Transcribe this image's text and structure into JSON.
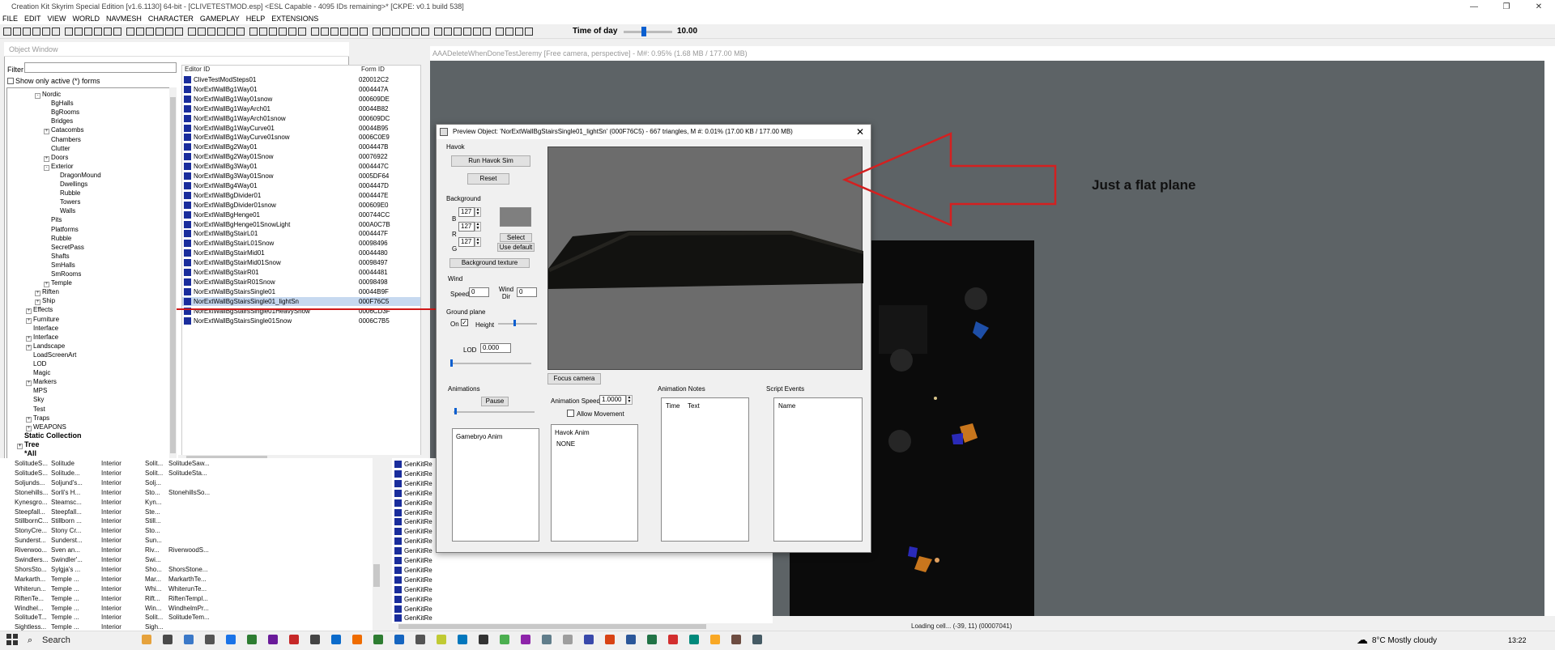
{
  "app": {
    "title": "Creation Kit Skyrim Special Edition [v1.6.1130] 64-bit - [CLIVETESTMOD.esp] <ESL Capable - 4095 IDs remaining>* [CKPE: v0.1 build 538]"
  },
  "menu": [
    "FILE",
    "EDIT",
    "VIEW",
    "WORLD",
    "NAVMESH",
    "CHARACTER",
    "GAMEPLAY",
    "HELP",
    "EXTENSIONS"
  ],
  "time_of_day": {
    "label": "Time of day",
    "value": "10.00",
    "level": 0.42
  },
  "object_window": {
    "title": "Object Window",
    "filter_label": "Filter",
    "filter_value": "",
    "active_only_label": "Show only active (*) forms",
    "col_editor_id": "Editor ID",
    "col_form_id": "Form ID",
    "tree": [
      {
        "label": "Nordic",
        "depth": 2,
        "exp": "-"
      },
      {
        "label": "BgHalls",
        "depth": 3,
        "exp": ""
      },
      {
        "label": "BgRooms",
        "depth": 3,
        "exp": ""
      },
      {
        "label": "Bridges",
        "depth": 3,
        "exp": ""
      },
      {
        "label": "Catacombs",
        "depth": 3,
        "exp": "+"
      },
      {
        "label": "Chambers",
        "depth": 3,
        "exp": ""
      },
      {
        "label": "Clutter",
        "depth": 3,
        "exp": ""
      },
      {
        "label": "Doors",
        "depth": 3,
        "exp": "+"
      },
      {
        "label": "Exterior",
        "depth": 3,
        "exp": "-"
      },
      {
        "label": "DragonMound",
        "depth": 4,
        "exp": ""
      },
      {
        "label": "Dwellings",
        "depth": 4,
        "exp": ""
      },
      {
        "label": "Rubble",
        "depth": 4,
        "exp": ""
      },
      {
        "label": "Towers",
        "depth": 4,
        "exp": ""
      },
      {
        "label": "Walls",
        "depth": 4,
        "exp": ""
      },
      {
        "label": "Pits",
        "depth": 3,
        "exp": ""
      },
      {
        "label": "Platforms",
        "depth": 3,
        "exp": ""
      },
      {
        "label": "Rubble",
        "depth": 3,
        "exp": ""
      },
      {
        "label": "SecretPass",
        "depth": 3,
        "exp": ""
      },
      {
        "label": "Shafts",
        "depth": 3,
        "exp": ""
      },
      {
        "label": "SmHalls",
        "depth": 3,
        "exp": ""
      },
      {
        "label": "SmRooms",
        "depth": 3,
        "exp": ""
      },
      {
        "label": "Temple",
        "depth": 3,
        "exp": "+"
      },
      {
        "label": "Riften",
        "depth": 2,
        "exp": "+"
      },
      {
        "label": "Ship",
        "depth": 2,
        "exp": "+"
      },
      {
        "label": "Effects",
        "depth": 1,
        "exp": "+"
      },
      {
        "label": "Furniture",
        "depth": 1,
        "exp": "+"
      },
      {
        "label": "Interface",
        "depth": 1,
        "exp": ""
      },
      {
        "label": "Interface",
        "depth": 1,
        "exp": "+"
      },
      {
        "label": "Landscape",
        "depth": 1,
        "exp": "+"
      },
      {
        "label": "LoadScreenArt",
        "depth": 1,
        "exp": ""
      },
      {
        "label": "LOD",
        "depth": 1,
        "exp": ""
      },
      {
        "label": "Magic",
        "depth": 1,
        "exp": ""
      },
      {
        "label": "Markers",
        "depth": 1,
        "exp": "+"
      },
      {
        "label": "MPS",
        "depth": 1,
        "exp": ""
      },
      {
        "label": "Sky",
        "depth": 1,
        "exp": ""
      },
      {
        "label": "Test",
        "depth": 1,
        "exp": ""
      },
      {
        "label": "Traps",
        "depth": 1,
        "exp": "+"
      },
      {
        "label": "WEAPONS",
        "depth": 1,
        "exp": "+"
      },
      {
        "label": "Static Collection",
        "depth": 0,
        "exp": "",
        "bold": true
      },
      {
        "label": "Tree",
        "depth": 0,
        "exp": "+",
        "bold": true
      },
      {
        "label": "*All",
        "depth": 0,
        "exp": "",
        "bold": true
      }
    ],
    "rows": [
      {
        "name": "CliveTestModSteps01",
        "id": "020012C2"
      },
      {
        "name": "NorExtWallBg1Way01",
        "id": "0004447A"
      },
      {
        "name": "NorExtWallBg1Way01snow",
        "id": "000609DE"
      },
      {
        "name": "NorExtWallBg1WayArch01",
        "id": "00044B82"
      },
      {
        "name": "NorExtWallBg1WayArch01snow",
        "id": "000609DC"
      },
      {
        "name": "NorExtWallBg1WayCurve01",
        "id": "00044B95"
      },
      {
        "name": "NorExtWallBg1WayCurve01snow",
        "id": "0006C0E9"
      },
      {
        "name": "NorExtWallBg2Way01",
        "id": "0004447B"
      },
      {
        "name": "NorExtWallBg2Way01Snow",
        "id": "00076922"
      },
      {
        "name": "NorExtWallBg3Way01",
        "id": "0004447C"
      },
      {
        "name": "NorExtWallBg3Way01Snow",
        "id": "0005DF64"
      },
      {
        "name": "NorExtWallBg4Way01",
        "id": "0004447D"
      },
      {
        "name": "NorExtWallBgDivider01",
        "id": "0004447E"
      },
      {
        "name": "NorExtWallBgDivider01snow",
        "id": "000609E0"
      },
      {
        "name": "NorExtWallBgHenge01",
        "id": "000744CC"
      },
      {
        "name": "NorExtWallBgHenge01SnowLight",
        "id": "000A0C7B"
      },
      {
        "name": "NorExtWallBgStairL01",
        "id": "0004447F"
      },
      {
        "name": "NorExtWallBgStairL01Snow",
        "id": "00098496"
      },
      {
        "name": "NorExtWallBgStairMid01",
        "id": "00044480"
      },
      {
        "name": "NorExtWallBgStairMid01Snow",
        "id": "00098497"
      },
      {
        "name": "NorExtWallBgStairR01",
        "id": "00044481"
      },
      {
        "name": "NorExtWallBgStairR01Snow",
        "id": "00098498"
      },
      {
        "name": "NorExtWallBgStairsSingle01",
        "id": "00044B9F"
      },
      {
        "name": "NorExtWallBgStairsSingle01_lightSn",
        "id": "000F76C5",
        "sel": true
      },
      {
        "name": "NorExtWallBgStairsSingle01HeavySnow",
        "id": "0006CD3F"
      },
      {
        "name": "NorExtWallBgStairsSingle01Snow",
        "id": "0006C7B5"
      }
    ]
  },
  "cells": [
    [
      "SolitudeS...",
      "Solitude",
      "Interior",
      "Solit...",
      "SolitudeSaw..."
    ],
    [
      "SolitudeS...",
      "Solitude...",
      "Interior",
      "Solit...",
      "SolitudeSta..."
    ],
    [
      "Soljunds...",
      "Soljund's...",
      "Interior",
      "Solj...",
      ""
    ],
    [
      "Stonehills...",
      "Sorli's H...",
      "Interior",
      "Sto...",
      "StonehillsSo..."
    ],
    [
      "Kynesgro...",
      "Steamsc...",
      "Interior",
      "Kyn...",
      ""
    ],
    [
      "Steepfall...",
      "Steepfall...",
      "Interior",
      "Ste...",
      ""
    ],
    [
      "StillbornC...",
      "Stillborn ...",
      "Interior",
      "Still...",
      ""
    ],
    [
      "StonyCre...",
      "Stony Cr...",
      "Interior",
      "Sto...",
      ""
    ],
    [
      "Sunderst...",
      "Sunderst...",
      "Interior",
      "Sun...",
      ""
    ],
    [
      "Riverwoo...",
      "Sven an...",
      "Interior",
      "Riv...",
      "RiverwoodS..."
    ],
    [
      "Swindlers...",
      "Swindler'...",
      "Interior",
      "Swi...",
      ""
    ],
    [
      "ShorsSto...",
      "Sylgja's ...",
      "Interior",
      "Sho...",
      "ShorsStone..."
    ],
    [
      "Markarth...",
      "Temple ...",
      "Interior",
      "Mar...",
      "MarkarthTe..."
    ],
    [
      "Whiterun...",
      "Temple ...",
      "Interior",
      "Whi...",
      "WhiterunTe..."
    ],
    [
      "RiftenTe...",
      "Temple ...",
      "Interior",
      "Rift...",
      "RiftenTempl..."
    ],
    [
      "Windhel...",
      "Temple ...",
      "Interior",
      "Win...",
      "WindhelmPr..."
    ],
    [
      "SolitudeT...",
      "Temple ...",
      "Interior",
      "Solit...",
      "SolitudeTem..."
    ],
    [
      "Sightless...",
      "Temple ...",
      "Interior",
      "Sigh...",
      ""
    ]
  ],
  "refs_label": "GenKitRe",
  "render": {
    "title": "AAADeleteWhenDoneTestJeremy [Free camera, perspective] - M#: 0.95% (1.68 MB / 177.00 MB)",
    "status": "Loading cell... (-39, 11) (00007041)"
  },
  "preview": {
    "title": "Preview Object: 'NorExtWallBgStairsSingle01_lightSn' (000F76C5) - 667 triangles, M #: 0.01% (17.00 KB / 177.00 MB)",
    "close": "✕",
    "havok_label": "Havok",
    "run_havok": "Run Havok Sim",
    "reset": "Reset",
    "background_label": "Background",
    "b_label": "B",
    "r_label": "R",
    "g_label": "G",
    "b_val": "127",
    "r_val": "127",
    "g_val": "127",
    "select": "Select",
    "use_default": "Use default",
    "bg_texture": "Background texture",
    "wind_label": "Wind",
    "speed_label": "Speed",
    "speed_val": "0",
    "wind_dir_label": "Wind Dir",
    "wind_dir_val": "0",
    "ground_label": "Ground plane",
    "on_label": "On",
    "height_label": "Height",
    "lod_label": "LOD",
    "lod_val": "0.000",
    "focus_camera": "Focus camera",
    "animations_label": "Animations",
    "pause": "Pause",
    "anim_speed_label": "Animation Speed",
    "anim_speed_val": "1.0000",
    "allow_movement": "Allow Movement",
    "gamebryo_anim": "Gamebryo Anim",
    "havok_anim": "Havok Anim",
    "havok_anim_val": "NONE",
    "anim_notes_label": "Animation Notes",
    "time_col": "Time",
    "text_col": "Text",
    "script_events_label": "Script Events",
    "name_col": "Name",
    "bg_color": "#7f7f7f"
  },
  "annotation": {
    "text": "Just a flat plane",
    "color": "#d42020"
  },
  "taskbar": {
    "search": "Search",
    "weather": "8°C  Mostly cloudy",
    "clock": "13:22"
  }
}
